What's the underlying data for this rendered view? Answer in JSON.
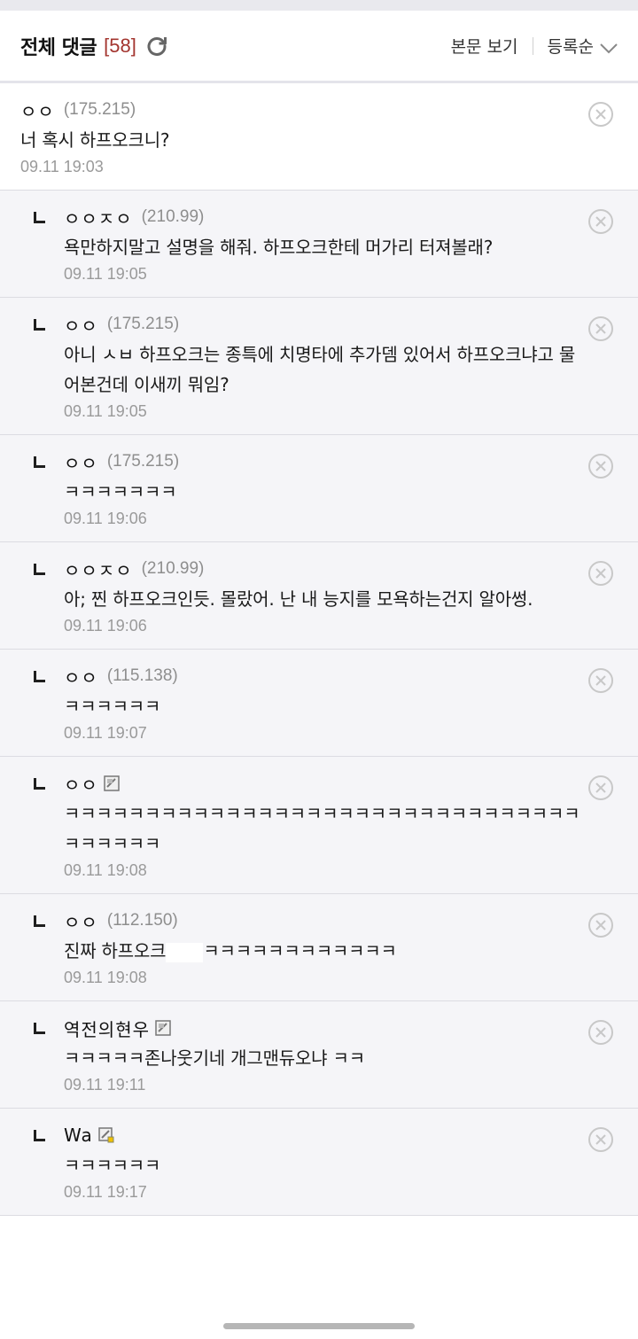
{
  "header": {
    "title": "전체 댓글",
    "count": "[58]",
    "view_body": "본문 보기",
    "sort": "등록순"
  },
  "comments": [
    {
      "author": "ㅇㅇ",
      "ip": "(175.215)",
      "text": "너 혹시 하프오크니?",
      "date": "09.11 19:03",
      "reply": false,
      "icon": ""
    },
    {
      "author": "ㅇㅇㅈㅇ",
      "ip": "(210.99)",
      "text": "욕만하지말고 설명을 해줘. 하프오크한테 머가리 터져볼래?",
      "date": "09.11 19:05",
      "reply": true,
      "icon": ""
    },
    {
      "author": "ㅇㅇ",
      "ip": "(175.215)",
      "text": "아니 ㅅㅂ 하프오크는 종특에 치명타에 추가뎀 있어서 하프오크냐고 물어본건데 이새끼 뭐임?",
      "date": "09.11 19:05",
      "reply": true,
      "icon": ""
    },
    {
      "author": "ㅇㅇ",
      "ip": "(175.215)",
      "text": "ㅋㅋㅋㅋㅋㅋㅋ",
      "date": "09.11 19:06",
      "reply": true,
      "icon": ""
    },
    {
      "author": "ㅇㅇㅈㅇ",
      "ip": "(210.99)",
      "text": "아; 찐 하프오크인듯. 몰랐어. 난 내 능지를 모욕하는건지 알아썽.",
      "date": "09.11 19:06",
      "reply": true,
      "icon": ""
    },
    {
      "author": "ㅇㅇ",
      "ip": "(115.138)",
      "text": "ㅋㅋㅋㅋㅋㅋ",
      "date": "09.11 19:07",
      "reply": true,
      "icon": ""
    },
    {
      "author": "ㅇㅇ",
      "ip": "",
      "text": "ㅋㅋㅋㅋㅋㅋㅋㅋㅋㅋㅋㅋㅋㅋㅋㅋㅋㅋㅋㅋㅋㅋㅋㅋㅋㅋㅋㅋㅋㅋㅋㅋㅋㅋㅋㅋㅋㅋ",
      "date": "09.11 19:08",
      "reply": true,
      "icon": "fixed-nick-icon"
    },
    {
      "author": "ㅇㅇ",
      "ip": "(112.150)",
      "text": "진짜 하프오크",
      "text_after_mask": "ㅋㅋㅋㅋㅋㅋㅋㅋㅋㅋㅋㅋ",
      "date": "09.11 19:08",
      "reply": true,
      "icon": ""
    },
    {
      "author": "역전의현우",
      "ip": "",
      "text": "ㅋㅋㅋㅋㅋ존나웃기네 개그맨듀오냐 ㅋㅋ",
      "date": "09.11 19:11",
      "reply": true,
      "icon": "fixed-nick-icon"
    },
    {
      "author": "Wa",
      "ip": "",
      "text": "ㅋㅋㅋㅋㅋㅋ",
      "date": "09.11 19:17",
      "reply": true,
      "icon": "semi-fixed-nick-icon"
    }
  ],
  "colors": {
    "count": "#a3352f",
    "reply_bg": "#f5f5f8",
    "date": "#9a9a9a"
  }
}
